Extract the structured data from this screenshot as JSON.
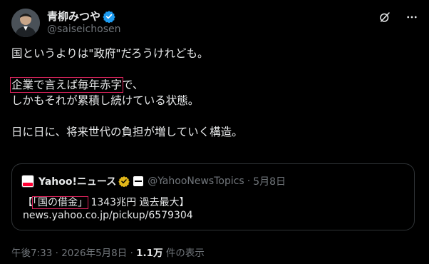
{
  "author": {
    "display_name": "青柳みつや",
    "handle": "@saiseichosen"
  },
  "tweet": {
    "line1": "国というよりは\"政府\"だろうけれども。",
    "line2_boxed": "企業で言えば毎年赤字",
    "line2_rest": "で、",
    "line3": "しかもそれが累積し続けている状態。",
    "line4": "日に日に、将来世代の負担が増していく構造。"
  },
  "quote": {
    "name": "Yahoo!ニュース",
    "handle": "@YahooNewsTopics",
    "dot": "·",
    "date": "5月8日",
    "headline_open": "【",
    "headline_boxed": "「国の借金」",
    "headline_rest": "1343兆円 過去最大】",
    "link": "news.yahoo.co.jp/pickup/6579304"
  },
  "meta": {
    "time": "午後7:33",
    "dot1": "·",
    "date": "2026年5月8日",
    "dot2": "·",
    "views": "1.1万",
    "views_label": "件の表示"
  },
  "icons": {
    "verified": "verified-badge-icon",
    "grok": "grok-icon",
    "more": "more-icon"
  },
  "colors": {
    "background": "#000000",
    "text": "#e7e9ea",
    "muted": "#71767b",
    "verified_blue": "#1d9bf0",
    "highlight_box": "#e0245e",
    "gold": "#e2b719"
  }
}
